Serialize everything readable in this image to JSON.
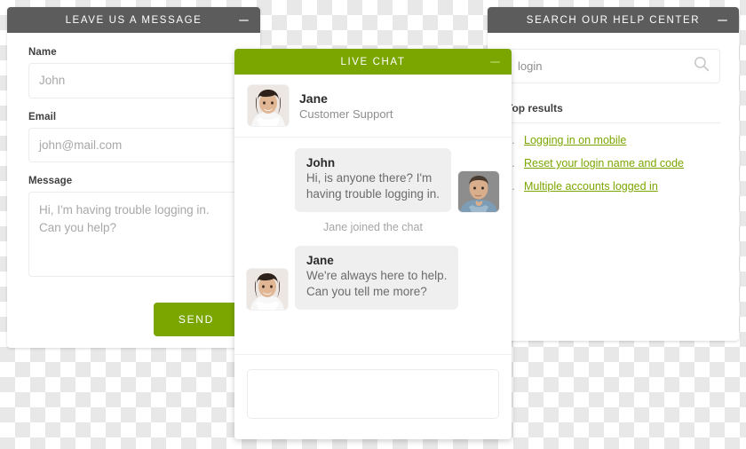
{
  "leave_message": {
    "title": "LEAVE US A MESSAGE",
    "minimize_icon": "minimize-icon",
    "fields": {
      "name_label": "Name",
      "name_placeholder": "John",
      "email_label": "Email",
      "email_placeholder": "john@mail.com",
      "message_label": "Message",
      "message_line1": "Hi, I'm having trouble logging in.",
      "message_line2": "Can you help?"
    },
    "send_label": "SEND"
  },
  "search_panel": {
    "title": "SEARCH OUR HELP CENTER",
    "minimize_icon": "minimize-icon",
    "search_value": "login",
    "search_placeholder": "login",
    "search_icon": "search-icon",
    "results_title": "Top results",
    "results": [
      {
        "num": "1.",
        "label": "Logging in on mobile"
      },
      {
        "num": "2.",
        "label": "Reset your login name and code"
      },
      {
        "num": "3.",
        "label": "Multiple accounts logged in"
      }
    ]
  },
  "live_chat": {
    "title": "LIVE CHAT",
    "minimize_icon": "minimize-icon",
    "agent": {
      "name": "Jane",
      "role": "Customer Support",
      "avatar": "agent-avatar"
    },
    "messages": [
      {
        "direction": "outgoing",
        "name": "John",
        "line1": "Hi, is anyone there? I'm",
        "line2": "having trouble logging in.",
        "avatar": "visitor-avatar"
      },
      {
        "direction": "incoming",
        "name": "Jane",
        "line1": "We're always here to help.",
        "line2": "Can you tell me more?",
        "avatar": "agent-avatar"
      }
    ],
    "system_note": "Jane joined the chat",
    "input_placeholder": ""
  },
  "colors": {
    "brand_green": "#7ba600",
    "header_grey": "#5c5c5c",
    "bubble_grey": "#efefef",
    "link_green": "#7ba600"
  }
}
